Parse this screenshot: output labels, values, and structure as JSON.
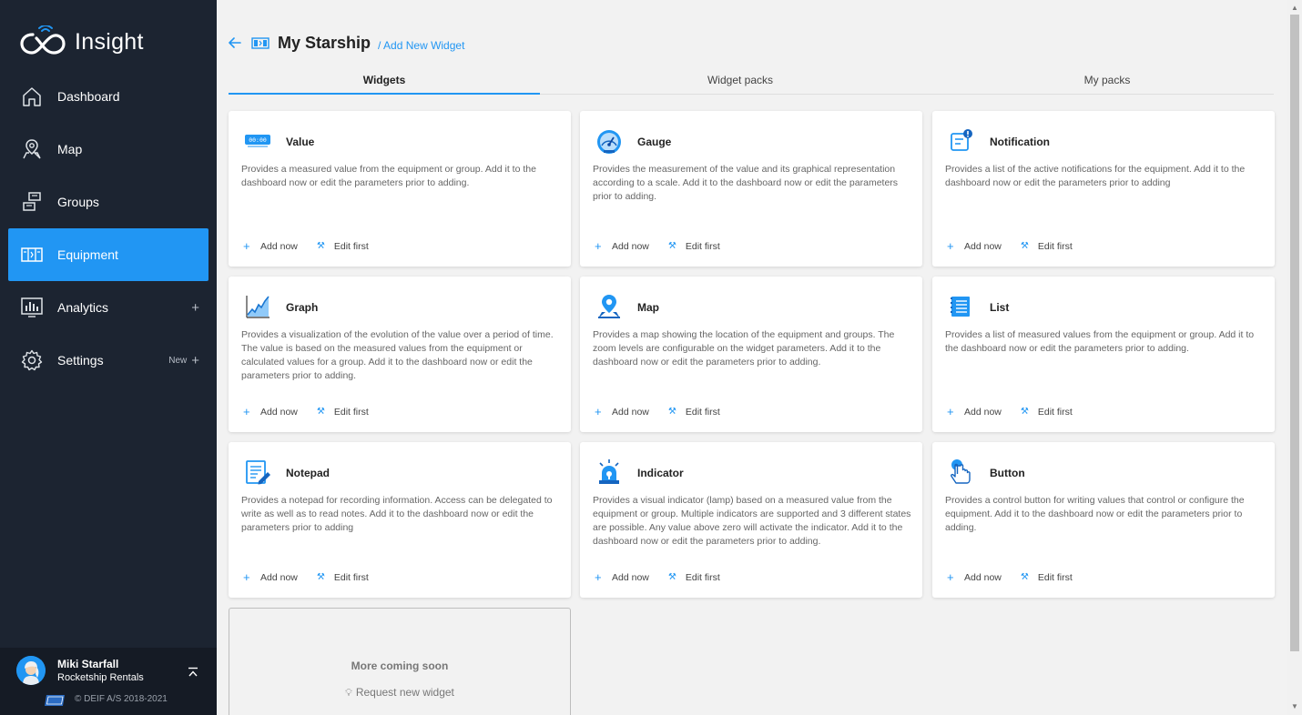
{
  "app": {
    "name": "Insight"
  },
  "sidebar": {
    "items": [
      {
        "label": "Dashboard",
        "icon": "home-icon"
      },
      {
        "label": "Map",
        "icon": "map-pin-icon"
      },
      {
        "label": "Groups",
        "icon": "groups-icon"
      },
      {
        "label": "Equipment",
        "icon": "equipment-icon",
        "active": true
      },
      {
        "label": "Analytics",
        "icon": "analytics-icon",
        "extra": "+"
      },
      {
        "label": "Settings",
        "icon": "gear-icon",
        "extra_badge": "New",
        "extra": "+"
      }
    ],
    "user": {
      "name": "Miki Starfall",
      "org": "Rocketship Rentals"
    },
    "copyright": "© DEIF A/S 2018-2021"
  },
  "header": {
    "title": "My Starship",
    "breadcrumb": "/ Add New Widget"
  },
  "tabs": [
    {
      "label": "Widgets",
      "active": true
    },
    {
      "label": "Widget packs"
    },
    {
      "label": "My packs"
    }
  ],
  "actions": {
    "add": "Add now",
    "edit": "Edit first"
  },
  "widgets": [
    {
      "title": "Value",
      "icon": "value-display-icon",
      "desc": "Provides a measured value from the equipment or group. Add it to the dashboard now or edit the parameters prior to adding."
    },
    {
      "title": "Gauge",
      "icon": "gauge-icon",
      "desc": "Provides the measurement of the value and its graphical representation according to a scale. Add it to the dashboard now or edit the parameters prior to adding."
    },
    {
      "title": "Notification",
      "icon": "notification-icon",
      "desc": "Provides a list of the active notifications for the equipment. Add it to the dashboard now or edit the parameters prior to adding"
    },
    {
      "title": "Graph",
      "icon": "graph-icon",
      "desc": "Provides a visualization of the evolution of the value over a period of time. The value is based on the measured values from the equipment or calculated values for a group. Add it to the dashboard now or edit the parameters prior to adding."
    },
    {
      "title": "Map",
      "icon": "map-icon",
      "desc": "Provides a map showing the location of the equipment and groups. The zoom levels are configurable on the widget parameters. Add it to the dashboard now or edit the parameters prior to adding."
    },
    {
      "title": "List",
      "icon": "list-icon",
      "desc": "Provides a list of measured values from the equipment or group. Add it to the dashboard now or edit the parameters prior to adding."
    },
    {
      "title": "Notepad",
      "icon": "notepad-icon",
      "desc": "Provides a notepad for recording information. Access can be delegated to write as well as to read notes. Add it to the dashboard now or edit the parameters prior to adding"
    },
    {
      "title": "Indicator",
      "icon": "indicator-lamp-icon",
      "desc": "Provides a visual indicator (lamp) based on a measured value from the equipment or group. Multiple indicators are supported and 3 different states are possible. Any value above zero will activate the indicator. Add it to the dashboard now or edit the parameters prior to adding."
    },
    {
      "title": "Button",
      "icon": "button-press-icon",
      "desc": "Provides a control button for writing values that control or configure the equipment. Add it to the dashboard now or edit the parameters prior to adding."
    }
  ],
  "value_icon_text": "00:00",
  "coming_soon": {
    "title": "More coming soon",
    "link": "Request new widget"
  },
  "colors": {
    "sidebar_bg": "#1c2431",
    "accent": "#2196f3",
    "page_bg": "#f2f2f2"
  }
}
